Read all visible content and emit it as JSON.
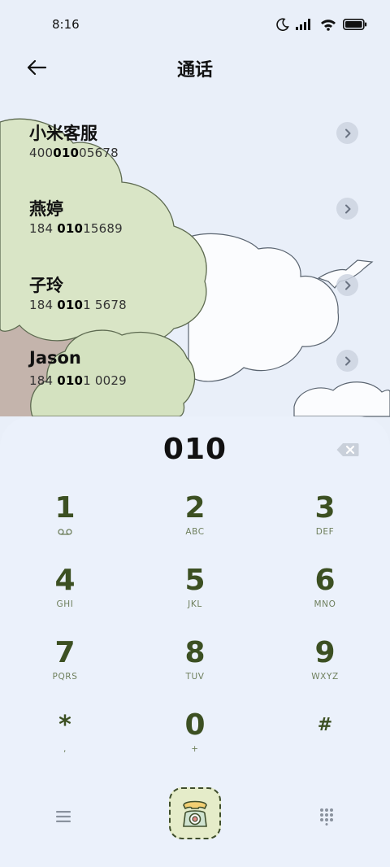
{
  "status_bar": {
    "time": "8:16"
  },
  "header": {
    "title": "通话"
  },
  "contacts": [
    {
      "name": "小米客服",
      "number_pre": "400",
      "number_match": "010",
      "number_post": "05678"
    },
    {
      "name": "燕婷",
      "number_pre": "184 ",
      "number_match": "010",
      "number_post": "15689"
    },
    {
      "name": "子玲",
      "number_pre": "184 ",
      "number_match": "010",
      "number_post": "1 5678"
    },
    {
      "name": "Jason",
      "number_pre": "184 ",
      "number_match": "010",
      "number_post": "1 0029"
    }
  ],
  "dialer": {
    "input": "010",
    "keys": [
      {
        "digit": "1",
        "letters": ""
      },
      {
        "digit": "2",
        "letters": "ABC"
      },
      {
        "digit": "3",
        "letters": "DEF"
      },
      {
        "digit": "4",
        "letters": "GHI"
      },
      {
        "digit": "5",
        "letters": "JKL"
      },
      {
        "digit": "6",
        "letters": "MNO"
      },
      {
        "digit": "7",
        "letters": "PQRS"
      },
      {
        "digit": "8",
        "letters": "TUV"
      },
      {
        "digit": "9",
        "letters": "WXYZ"
      },
      {
        "digit": "*",
        "letters": ","
      },
      {
        "digit": "0",
        "letters": "+"
      },
      {
        "digit": "#",
        "letters": ""
      }
    ]
  },
  "icons": {
    "voicemail": "voicemail-icon",
    "back": "arrow-left-icon",
    "backspace": "backspace-icon",
    "menu": "menu-icon",
    "call": "telephone-icon",
    "keypad": "keypad-grid-icon"
  },
  "colors": {
    "accent": "#3c5022",
    "background": "#e9eff9",
    "call_button": "#e5ecc9"
  }
}
